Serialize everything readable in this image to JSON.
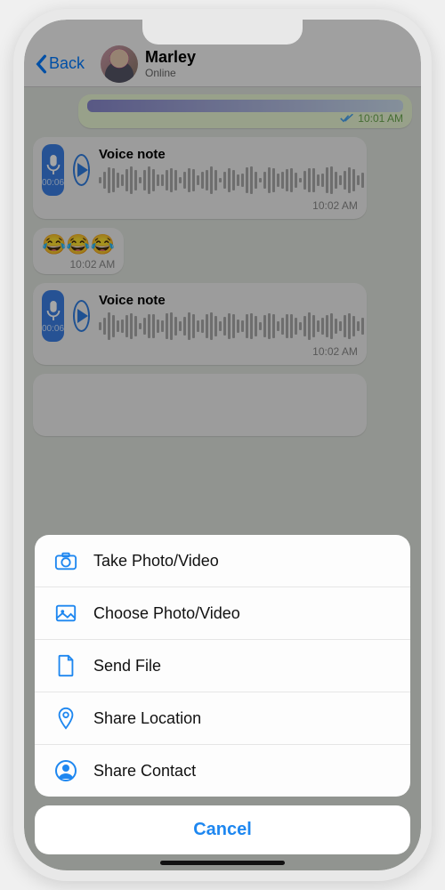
{
  "header": {
    "back_label": "Back",
    "contact_name": "Marley",
    "contact_status": "Online"
  },
  "messages": {
    "sent_voice_time": "10:01 AM",
    "voice1": {
      "title": "Voice note",
      "duration": "00:06",
      "time": "10:02 AM"
    },
    "emoji_text": "😂😂😂",
    "emoji_time": "10:02 AM",
    "voice2": {
      "title": "Voice note",
      "duration": "00:06",
      "time": "10:02 AM"
    }
  },
  "sheet": {
    "items": [
      {
        "icon": "camera-icon",
        "label": "Take Photo/Video"
      },
      {
        "icon": "gallery-icon",
        "label": "Choose Photo/Video"
      },
      {
        "icon": "file-icon",
        "label": "Send File"
      },
      {
        "icon": "location-icon",
        "label": "Share Location"
      },
      {
        "icon": "contact-icon",
        "label": "Share Contact"
      }
    ],
    "cancel_label": "Cancel"
  }
}
